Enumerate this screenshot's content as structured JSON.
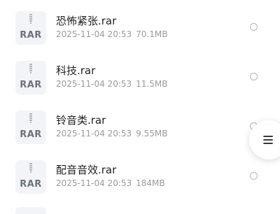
{
  "files": [
    {
      "icon": "rar-archive-icon",
      "type_label": "RAR",
      "name": "恐怖紧张.rar",
      "date": "2025-11-04 20:53",
      "size": "70.1MB"
    },
    {
      "icon": "rar-archive-icon",
      "type_label": "RAR",
      "name": "科技.rar",
      "date": "2025-11-04 20:53",
      "size": "11.5MB"
    },
    {
      "icon": "rar-archive-icon",
      "type_label": "RAR",
      "name": "铃音类.rar",
      "date": "2025-11-04 20:53",
      "size": "9.55MB"
    },
    {
      "icon": "rar-archive-icon",
      "type_label": "RAR",
      "name": "配音音效.rar",
      "date": "2025-11-04 20:53",
      "size": "184MB"
    }
  ],
  "floating_button": {
    "icon": "menu-icon"
  },
  "colors": {
    "icon_bg": "#f3f4f7",
    "icon_text": "#6c7280",
    "name_text": "#1f1f1f",
    "meta_text": "#9a9a9a",
    "radio_border": "#b5b5b5"
  }
}
